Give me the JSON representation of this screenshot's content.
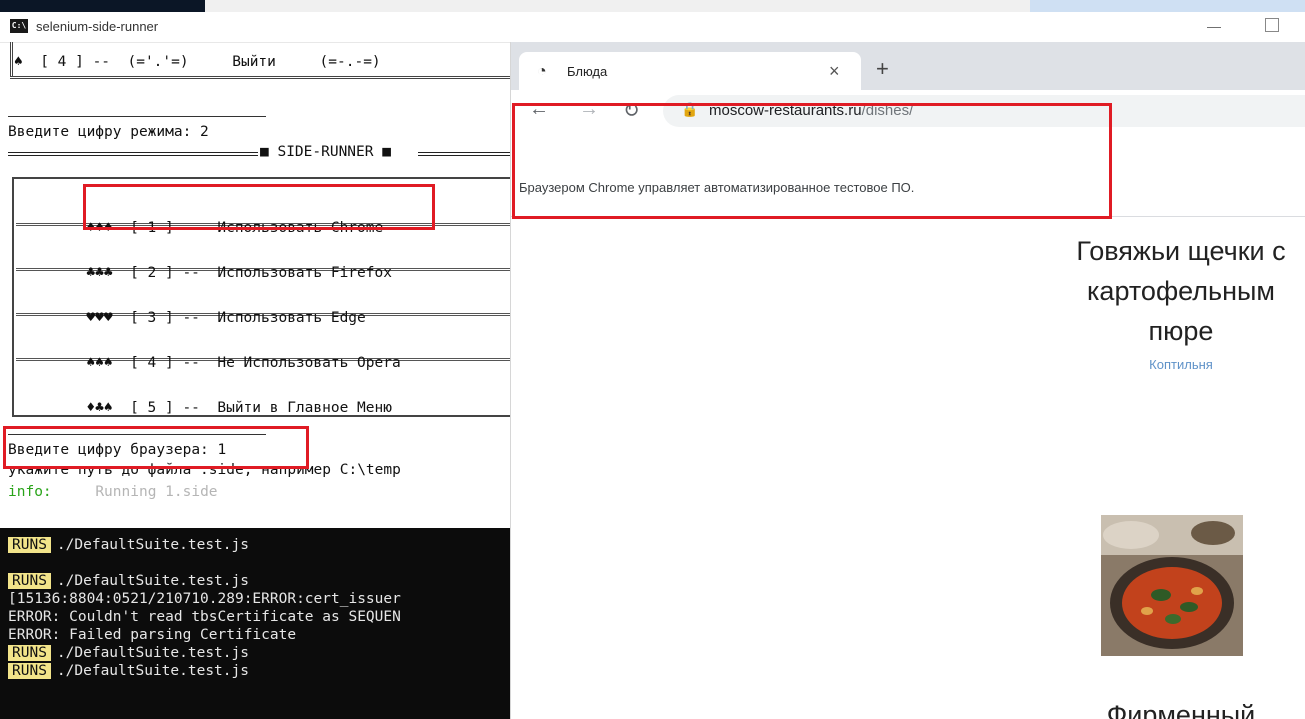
{
  "console": {
    "title": "selenium-side-runner",
    "lines": {
      "prev_menu": "♠  [ 4 ] --  (='.'=)     Выйти     (=-.-=)",
      "mode_prompt": "Введите цифру режима: 2",
      "side_runner_header": "■ SIDE-RUNNER ■",
      "browser_prompt": "Введите цифру браузера: 1",
      "path_prompt": "укажите путь до файла .side, например C:\\temp",
      "info_label": "info:",
      "info_text": "Running 1.side"
    },
    "menu_items": [
      {
        "suit": "♦♦♦",
        "text": "[ 1 ] --  Использовать Chrome"
      },
      {
        "suit": "♣♣♣",
        "text": "[ 2 ] --  Использовать Firefox"
      },
      {
        "suit": "♥♥♥",
        "text": "[ 3 ] --  Использовать Edge"
      },
      {
        "suit": "♠♠♠",
        "text": "[ 4 ] --  Не Использовать Opera"
      },
      {
        "suit": "♦♣♠",
        "text": "[ 5 ] --  Выйти в Главное Меню"
      }
    ],
    "output": {
      "runs_label": "RUNS",
      "runs_file": "./DefaultSuite.test.js",
      "error_line_1": "[15136:8804:0521/210710.289:ERROR:cert_issuer",
      "error_line_2": "ERROR: Couldn't read tbsCertificate as SEQUEN",
      "error_line_3": "ERROR: Failed parsing Certificate"
    }
  },
  "browser": {
    "tab_title": "Блюда",
    "new_tab_label": "+",
    "close_tab_label": "×",
    "url_host": "moscow-restaurants.ru",
    "url_path": "/dishes/",
    "automation_notice": "Браузером Chrome управляет автоматизированное тестовое ПО.",
    "dish": {
      "title_line_1": "Говяжьи щечки с",
      "title_line_2": "картофельным",
      "title_line_3": "пюре",
      "category": "Коптильня",
      "next_title": "Фирменный"
    }
  },
  "colors": {
    "highlight_red": "#e01b24",
    "runs_badge": "#f2e48a",
    "info_green": "#2aa41a",
    "link_blue": "#5f92c8"
  }
}
